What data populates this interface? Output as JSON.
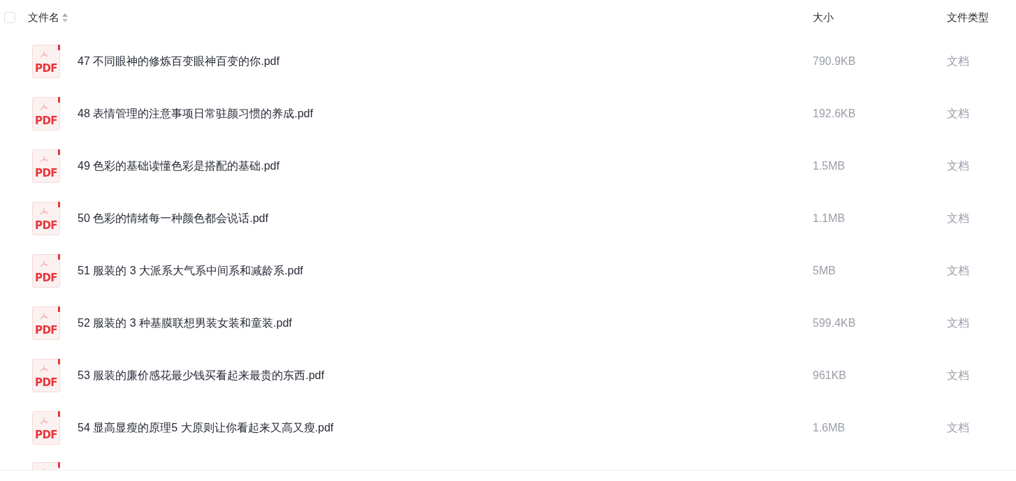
{
  "header": {
    "select_all_checked": false,
    "columns": [
      {
        "label": "文件名",
        "sortable": true
      },
      {
        "label": "大小",
        "sortable": false
      },
      {
        "label": "文件类型",
        "sortable": false
      }
    ]
  },
  "rows": [
    {
      "icon_label": "PDF",
      "name": "47 不同眼神的修炼百变眼神百变的你.pdf",
      "size": "790.9KB",
      "type": "文档"
    },
    {
      "icon_label": "PDF",
      "name": "48 表情管理的注意事项日常驻颜习惯的养成.pdf",
      "size": "192.6KB",
      "type": "文档"
    },
    {
      "icon_label": "PDF",
      "name": "49 色彩的基础读懂色彩是搭配的基础.pdf",
      "size": "1.5MB",
      "type": "文档"
    },
    {
      "icon_label": "PDF",
      "name": "50 色彩的情绪每一种颜色都会说话.pdf",
      "size": "1.1MB",
      "type": "文档"
    },
    {
      "icon_label": "PDF",
      "name": "51 服装的 3 大派系大气系中间系和减龄系.pdf",
      "size": "5MB",
      "type": "文档"
    },
    {
      "icon_label": "PDF",
      "name": "52 服装的 3 种基膜联想男装女装和童装.pdf",
      "size": "599.4KB",
      "type": "文档"
    },
    {
      "icon_label": "PDF",
      "name": "53 服装的廉价感花最少钱买看起来最贵的东西.pdf",
      "size": "961KB",
      "type": "文档"
    },
    {
      "icon_label": "PDF",
      "name": "54 显高显瘦的原理5 大原则让你看起来又高又瘦.pdf",
      "size": "1.6MB",
      "type": "文档"
    }
  ],
  "cut_off_row": {
    "kind": "pdf"
  }
}
